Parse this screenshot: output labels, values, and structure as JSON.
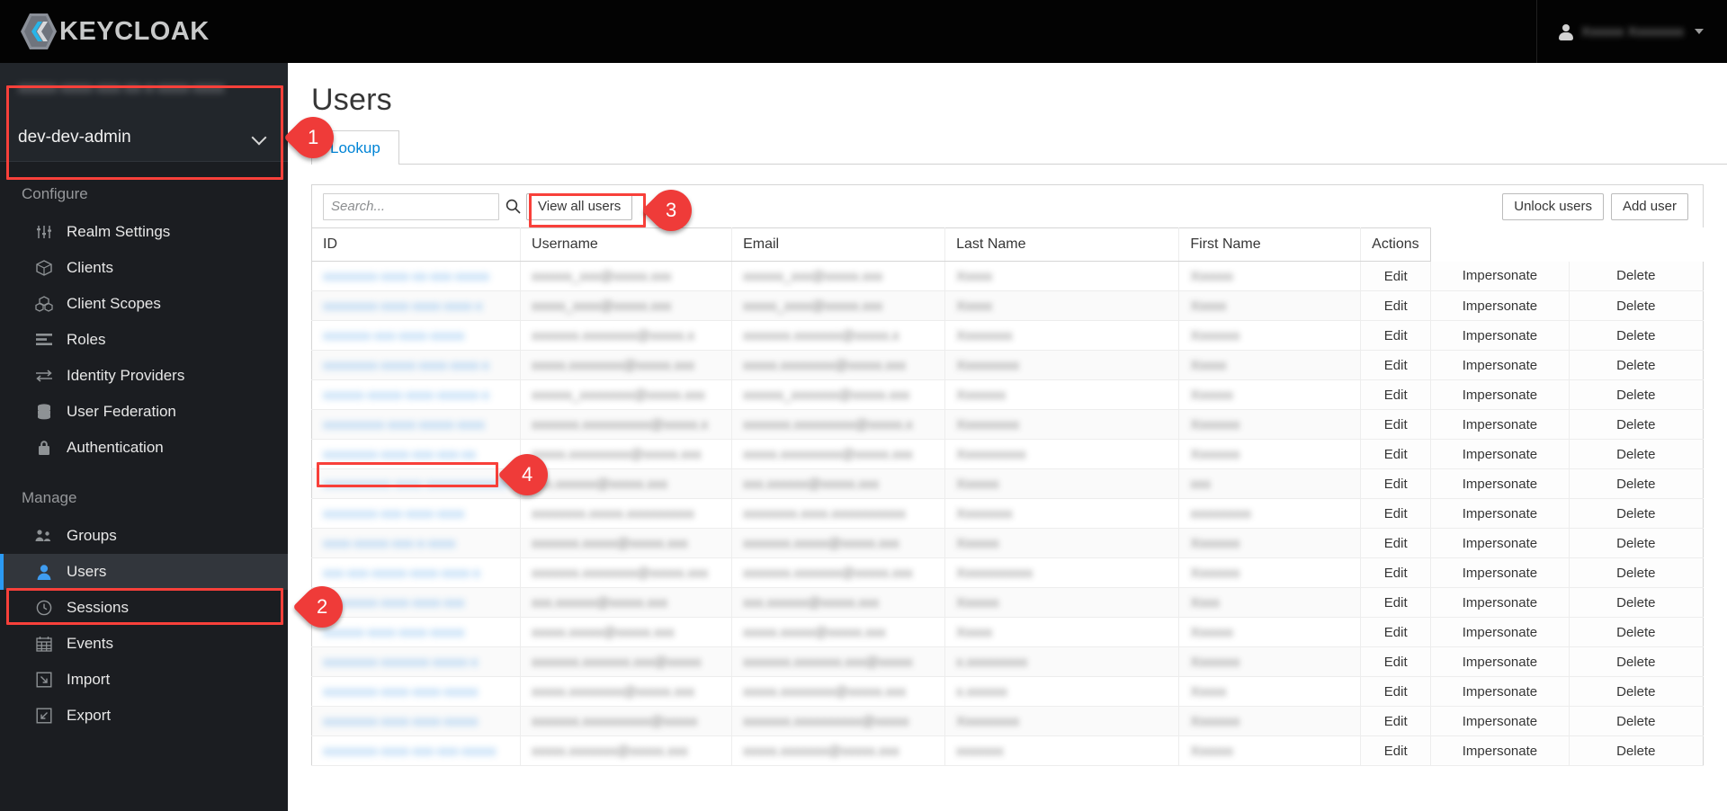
{
  "app": {
    "brand_name": "KEYCLOAK",
    "brand_logo_icon": "keycloak-logo-icon"
  },
  "masthead": {
    "user_icon": "user-avatar-icon",
    "user_name": "Xxxxxx Xxxxxxxx",
    "caret_icon": "chevron-down-icon"
  },
  "sidebar": {
    "realm": {
      "blurred_label": "xxxxx-xxxx-xxx-xx-x-xxxx-xxxx",
      "current": "dev-dev-admin",
      "caret_icon": "chevron-down-icon"
    },
    "sections": [
      {
        "title": "Configure",
        "items": [
          {
            "label": "Realm Settings",
            "icon": "sliders-icon",
            "active": false
          },
          {
            "label": "Clients",
            "icon": "cube-icon",
            "active": false
          },
          {
            "label": "Client Scopes",
            "icon": "cubes-icon",
            "active": false
          },
          {
            "label": "Roles",
            "icon": "list-bars-icon",
            "active": false
          },
          {
            "label": "Identity Providers",
            "icon": "exchange-arrows-icon",
            "active": false
          },
          {
            "label": "User Federation",
            "icon": "database-icon",
            "active": false
          },
          {
            "label": "Authentication",
            "icon": "lock-icon",
            "active": false
          }
        ]
      },
      {
        "title": "Manage",
        "items": [
          {
            "label": "Groups",
            "icon": "users-group-icon",
            "active": false
          },
          {
            "label": "Users",
            "icon": "user-icon",
            "active": true
          },
          {
            "label": "Sessions",
            "icon": "clock-icon",
            "active": false
          },
          {
            "label": "Events",
            "icon": "calendar-icon",
            "active": false
          },
          {
            "label": "Import",
            "icon": "import-arrow-icon",
            "active": false
          },
          {
            "label": "Export",
            "icon": "export-arrow-icon",
            "active": false
          }
        ]
      }
    ]
  },
  "main": {
    "page_title": "Users",
    "tabs": [
      {
        "label": "Lookup",
        "active": true
      }
    ],
    "toolbar": {
      "search_placeholder": "Search...",
      "search_value": "",
      "search_icon": "search-icon",
      "view_all_users_label": "View all users",
      "unlock_users_label": "Unlock users",
      "add_user_label": "Add user"
    },
    "table": {
      "columns": [
        "ID",
        "Username",
        "Email",
        "Last Name",
        "First Name",
        "Actions"
      ],
      "action_labels": [
        "Edit",
        "Impersonate",
        "Delete"
      ],
      "rows": [
        {
          "id": "xxxxxxxx-xxxx-xx-xxx-xxxxx",
          "username": "xxxxxx_xxx@xxxxx.xxx",
          "email": "xxxxxx_xxx@xxxxx.xxx",
          "last_name": "Xxxxx",
          "first_name": "Xxxxxx"
        },
        {
          "id": "xxxxxxxx-xxxx-xxxx-xxxx-x",
          "username": "xxxxx_xxxx@xxxxx.xxx",
          "email": "xxxxx_xxxx@xxxxx.xxx",
          "last_name": "Xxxxx",
          "first_name": "Xxxxx"
        },
        {
          "id": "xxxxxxx-xxx-xxxx-xxxxx",
          "username": "xxxxxxx.xxxxxxxx@xxxxx.x",
          "email": "xxxxxxx.xxxxxxx@xxxxx.x",
          "last_name": "Xxxxxxxx",
          "first_name": "Xxxxxxx"
        },
        {
          "id": "xxxxxxxx-xxxxx-xxxx-xxxx-x",
          "username": "xxxxx.xxxxxxxx@xxxxx.xxx",
          "email": "xxxxx.xxxxxxxx@xxxxx.xxx",
          "last_name": "Xxxxxxxxx",
          "first_name": "Xxxxx"
        },
        {
          "id": "xxxxxx-xxxxx-xxxx-xxxxxx-x",
          "username": "xxxxxx_xxxxxxxx@xxxxx.xxx",
          "email": "xxxxxx_xxxxxxx@xxxxx.xxx",
          "last_name": "Xxxxxxx",
          "first_name": "Xxxxxx"
        },
        {
          "id": "xxxxxxxxx-xxxx-xxxxx-xxxx",
          "username": "xxxxxxx.xxxxxxxxxx@xxxxx.x",
          "email": "xxxxxxx.xxxxxxxxx@xxxxx.x",
          "last_name": "Xxxxxxxxx",
          "first_name": "Xxxxxxx"
        },
        {
          "id": "xxxxxxxx-xxxx-xxx-xxx-xx",
          "username": "xxxxx.xxxxxxxxx@xxxxx.xxx",
          "email": "xxxxx.xxxxxxxxx@xxxxx.xxx",
          "last_name": "Xxxxxxxxxx",
          "first_name": "Xxxxxxx"
        },
        {
          "id": "xxxxxxxxxx-xxxx-xxxxxxxxxxxx",
          "username": "xxx.xxxxxx@xxxxx.xxx",
          "email": "xxx.xxxxxx@xxxxx.xxx",
          "last_name": "Xxxxxx",
          "first_name": "xxx"
        },
        {
          "id": "xxxxxxxx-xxx-xxxx-xxxx",
          "username": "xxxxxxxx.xxxxx.xxxxxxxxxx",
          "email": "xxxxxxxx.xxxx.xxxxxxxxxxx",
          "last_name": "Xxxxxxxx",
          "first_name": "xxxxxxxxx"
        },
        {
          "id": "xxxx-xxxxx-xxx-x-xxxx",
          "username": "xxxxxxx.xxxxx@xxxxx.xxx",
          "email": "xxxxxxx.xxxxx@xxxxx.xxx",
          "last_name": "Xxxxxx",
          "first_name": "Xxxxxxx"
        },
        {
          "id": "xxx-xxx-xxxxx-xxxx-xxxx-x",
          "username": "xxxxxxx.xxxxxxxx@xxxxx.xxx",
          "email": "xxxxxxx.xxxxxxx@xxxxx.xxx",
          "last_name": "Xxxxxxxxxxx",
          "first_name": "Xxxxxxx"
        },
        {
          "id": "xxxxxxxx-xxxx-xxxx-xxx",
          "username": "xxx.xxxxxx@xxxxx.xxx",
          "email": "xxx.xxxxxx@xxxxx.xxx",
          "last_name": "Xxxxxx",
          "first_name": "Xxxx"
        },
        {
          "id": "xxxxxx-xxxx-xxxx-xxxxx",
          "username": "xxxxx.xxxxx@xxxxx.xxx",
          "email": "xxxxx.xxxxx@xxxxx.xxx",
          "last_name": "Xxxxx",
          "first_name": "Xxxxxx"
        },
        {
          "id": "xxxxxxxx-xxxxxxx-xxxxx-x",
          "username": "xxxxxxx.xxxxxxx.xxx@xxxxx",
          "email": "xxxxxxx.xxxxxxx.xxx@xxxxx",
          "last_name": "x.xxxxxxxxx",
          "first_name": "Xxxxxxx"
        },
        {
          "id": "xxxxxxxx-xxxx-xxxx-xxxxx",
          "username": "xxxxx.xxxxxxxx@xxxxx.xxx",
          "email": "xxxxx.xxxxxxxx@xxxxx.xxx",
          "last_name": "x.xxxxxx",
          "first_name": "Xxxxx"
        },
        {
          "id": "xxxxxxxx-xxxx-xxxx-xxxxx",
          "username": "xxxxxxx.xxxxxxxxxx@xxxxx",
          "email": "xxxxxxx.xxxxxxxxxx@xxxxx",
          "last_name": "Xxxxxxxxx",
          "first_name": "Xxxxxxx"
        },
        {
          "id": "xxxxxxxx-xxxx-xxx-xxx-xxxxx",
          "username": "xxxxx.xxxxxxx@xxxxx.xxx",
          "email": "xxxxx.xxxxxxx@xxxxx.xxx",
          "last_name": "xxxxxxx",
          "first_name": "Xxxxxx"
        }
      ],
      "highlighted_row_index": 7
    }
  },
  "annotations": [
    {
      "number": "1",
      "target": "realm-selector"
    },
    {
      "number": "2",
      "target": "sidebar-item-users"
    },
    {
      "number": "3",
      "target": "view-all-users-button"
    },
    {
      "number": "4",
      "target": "user-id-cell"
    }
  ],
  "colors": {
    "masthead_bg": "#030303",
    "sidebar_bg": "#1b1d21",
    "accent_blue": "#0084d6",
    "annotation_red": "#ef3b39",
    "active_nav_bar": "#2b9af3"
  }
}
